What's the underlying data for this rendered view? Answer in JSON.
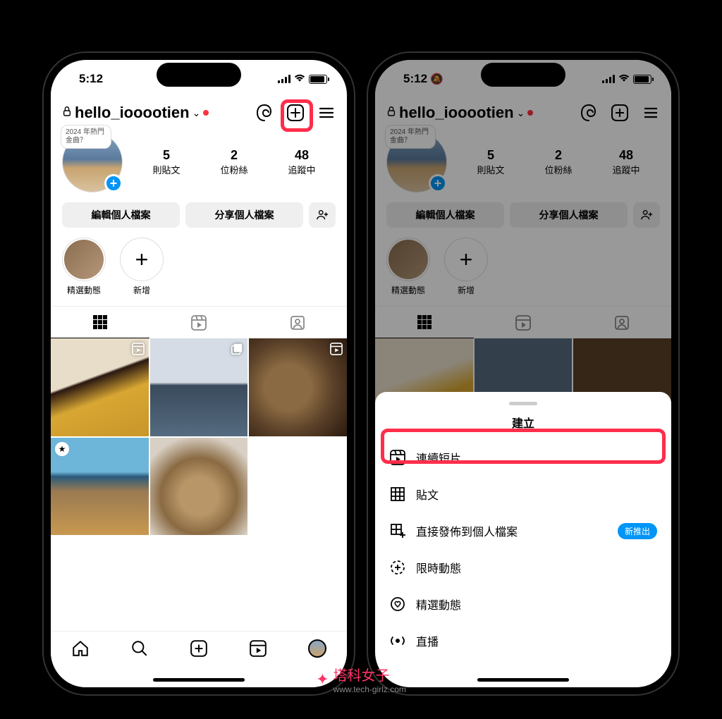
{
  "status": {
    "time": "5:12"
  },
  "profile": {
    "username": "hello_iooootien",
    "story_hint": "2024 年熱門金曲？",
    "stats": {
      "posts": {
        "num": "5",
        "label": "則貼文"
      },
      "followers": {
        "num": "2",
        "label": "位粉絲"
      },
      "following": {
        "num": "48",
        "label": "追蹤中"
      }
    },
    "actions": {
      "edit": "編輯個人檔案",
      "share": "分享個人檔案"
    },
    "highlights": {
      "featured": "精選動態",
      "new": "新增"
    }
  },
  "sheet": {
    "title": "建立",
    "items": {
      "reel": "連續短片",
      "post": "貼文",
      "direct": "直接發佈到個人檔案",
      "story": "限時動態",
      "highlight": "精選動態",
      "live": "直播"
    },
    "badge_new": "新推出"
  },
  "watermark": {
    "brand": "塔科女子",
    "url": "www.tech-girlz.com"
  }
}
